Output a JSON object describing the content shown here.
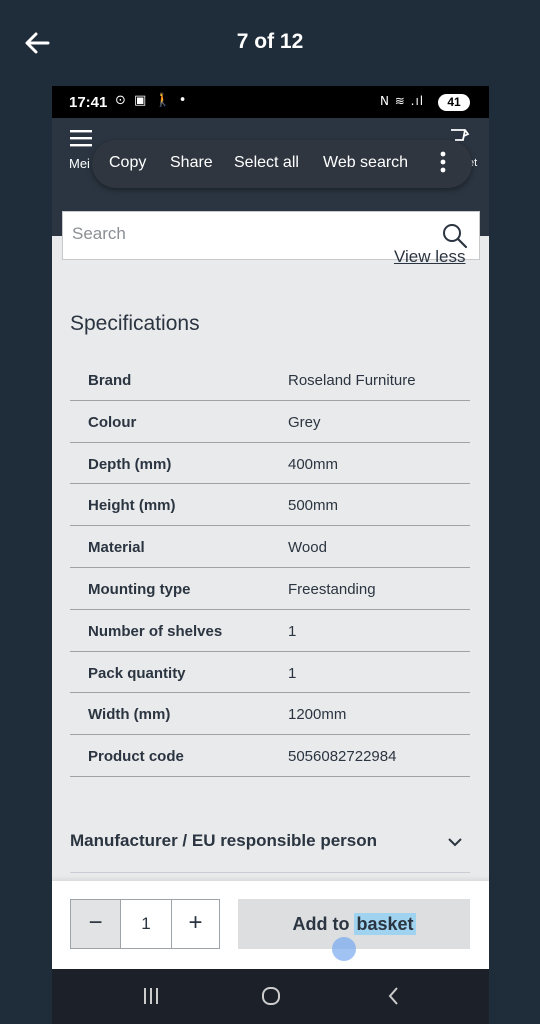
{
  "viewer": {
    "title": "7 of 12"
  },
  "status_bar": {
    "time": "17:41",
    "left_icons": "⊙ ▣ 🚶 •",
    "right_icons": "N ≋ .ıl",
    "battery": "41"
  },
  "app_header": {
    "menu_label": "Mei",
    "right_label": "et"
  },
  "context_menu": {
    "items": [
      "Copy",
      "Share",
      "Select all",
      "Web search"
    ]
  },
  "search": {
    "placeholder": "Search"
  },
  "view_less_label": "View less",
  "specifications": {
    "title": "Specifications",
    "rows": [
      {
        "key": "Brand",
        "value": "Roseland Furniture"
      },
      {
        "key": "Colour",
        "value": "Grey"
      },
      {
        "key": "Depth (mm)",
        "value": "400mm"
      },
      {
        "key": "Height (mm)",
        "value": "500mm"
      },
      {
        "key": "Material",
        "value": "Wood"
      },
      {
        "key": "Mounting type",
        "value": "Freestanding"
      },
      {
        "key": "Number of shelves",
        "value": "1"
      },
      {
        "key": "Pack quantity",
        "value": "1"
      },
      {
        "key": "Width (mm)",
        "value": "1200mm"
      },
      {
        "key": "Product code",
        "value": "5056082722984"
      }
    ]
  },
  "manufacturer_label": "Manufacturer / EU responsible person",
  "basket": {
    "minus": "−",
    "quantity": "1",
    "plus": "+",
    "add_label_prefix": "Add to ",
    "add_label_highlight": "basket"
  },
  "colors": {
    "header": "#2b3541",
    "accent": "#f06a1c",
    "background": "#1f2d3b"
  }
}
